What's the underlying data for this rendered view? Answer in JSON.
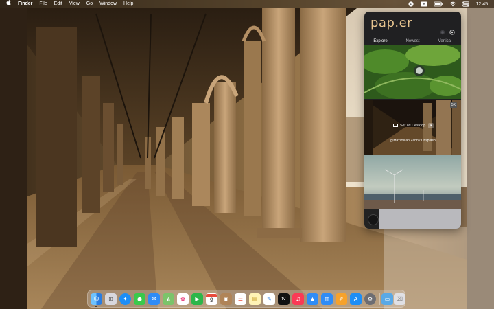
{
  "menubar": {
    "apple_icon": "apple-icon",
    "app_name": "Finder",
    "menus": [
      "File",
      "Edit",
      "View",
      "Go",
      "Window",
      "Help"
    ],
    "status_icons": [
      "paper-icon",
      "input-source-icon",
      "battery-icon",
      "wifi-icon",
      "control-center-icon"
    ],
    "input_source_label": "A",
    "clock": "12:45"
  },
  "paper_app": {
    "logo": "pap.er",
    "header_icons": [
      "record-icon",
      "settings-gear-icon"
    ],
    "tabs": [
      {
        "label": "Explore",
        "active": true
      },
      {
        "label": "Newest",
        "active": false
      },
      {
        "label": "Vertical",
        "active": false
      }
    ],
    "thumbnails": [
      {
        "name": "leaf-photo"
      },
      {
        "name": "arcade-photo",
        "resolution_badge": "5K",
        "action": "Set as Desktop",
        "credit": "@Maximilian Zahn / Unsplash"
      },
      {
        "name": "wind-turbine-photo"
      },
      {
        "name": "snow-photo"
      }
    ]
  },
  "dock": {
    "apps": [
      "Finder",
      "Launchpad",
      "Safari",
      "Messages",
      "Mail",
      "Maps",
      "Photos",
      "FaceTime",
      "Calendar",
      "Contacts",
      "Reminders",
      "Notes",
      "TV",
      "Music",
      "Podcasts",
      "Keynote",
      "Pages",
      "App Store",
      "System Preferences"
    ],
    "calendar_day": "9",
    "tv_label": "tv",
    "trailing": [
      "Downloads",
      "Trash"
    ],
    "accent": "#2a7de1"
  }
}
